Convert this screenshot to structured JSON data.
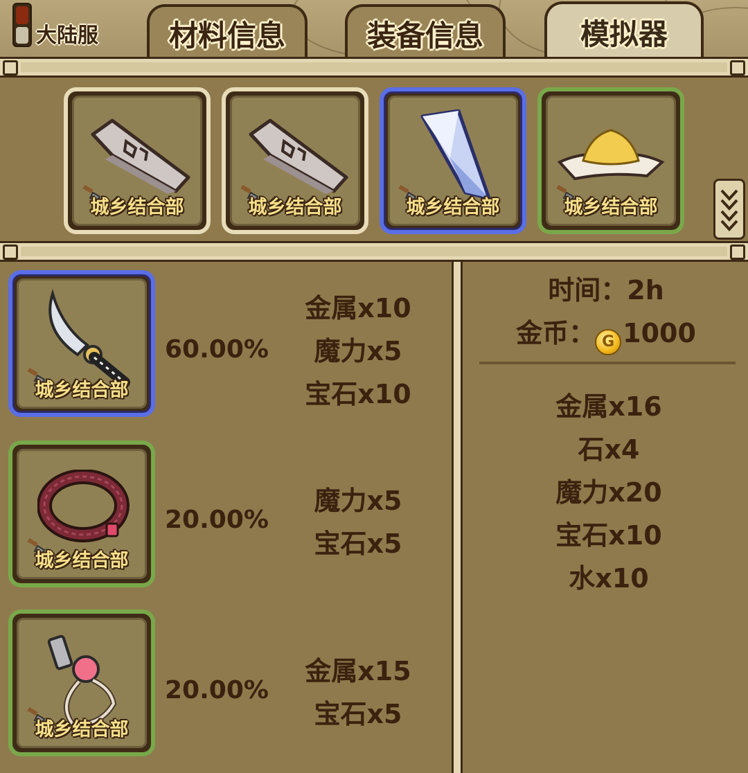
{
  "header": {
    "server_label": "大陆服",
    "tabs": [
      {
        "label": "材料信息",
        "active": false
      },
      {
        "label": "装备信息",
        "active": false
      },
      {
        "label": "模拟器",
        "active": true
      }
    ]
  },
  "materials": [
    {
      "icon": "stone-slab-icon",
      "source": "城乡结合部",
      "rarity": "common"
    },
    {
      "icon": "stone-slab-icon",
      "source": "城乡结合部",
      "rarity": "common"
    },
    {
      "icon": "crystal-icon",
      "source": "城乡结合部",
      "rarity": "rare"
    },
    {
      "icon": "sand-pile-icon",
      "source": "城乡结合部",
      "rarity": "uncommon"
    }
  ],
  "outcomes": [
    {
      "icon": "scimitar-icon",
      "source": "城乡结合部",
      "rarity": "rare",
      "chance": "60.00%",
      "requirements": [
        "金属x10",
        "魔力x5",
        "宝石x10"
      ]
    },
    {
      "icon": "bracelet-icon",
      "source": "城乡结合部",
      "rarity": "uncommon",
      "chance": "20.00%",
      "requirements": [
        "魔力x5",
        "宝石x5"
      ]
    },
    {
      "icon": "whistle-icon",
      "source": "城乡结合部",
      "rarity": "uncommon",
      "chance": "20.00%",
      "requirements": [
        "金属x15",
        "宝石x5"
      ]
    }
  ],
  "summary": {
    "time": "时间：2h",
    "gold_label": "金币：",
    "gold_value": "1000",
    "totals": [
      "金属x16",
      "石x4",
      "魔力x20",
      "宝石x10",
      "水x10"
    ]
  },
  "colors": {
    "panel_bg": "#8f7a4d",
    "rare_border": "#5a6ee6",
    "uncommon_border": "#79a84a",
    "common_border": "#e8dcb8",
    "tag_text": "#f7e08a"
  }
}
